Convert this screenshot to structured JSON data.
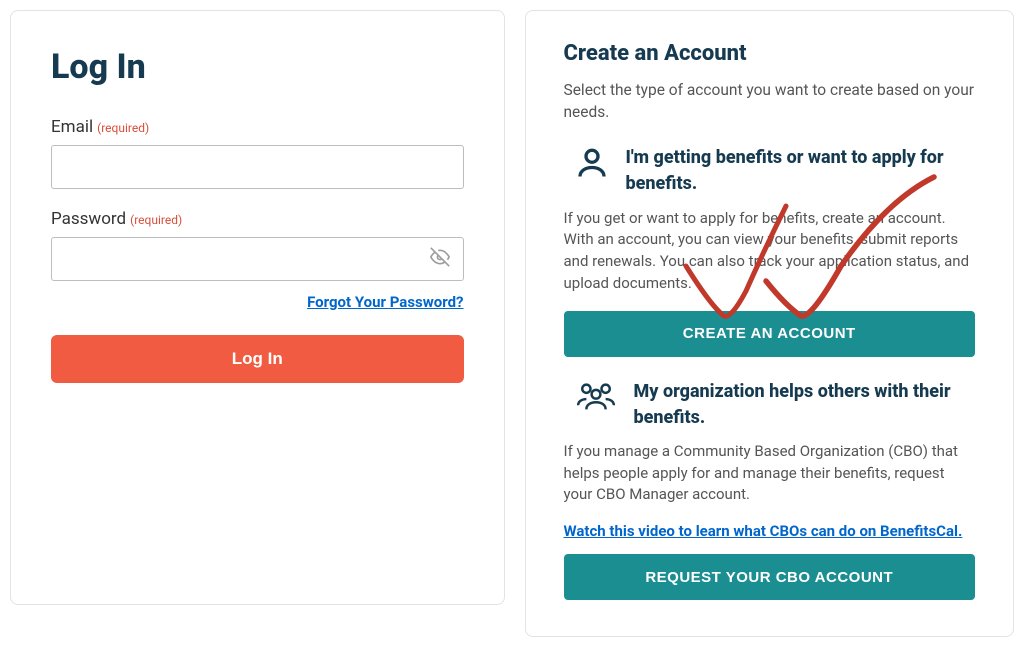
{
  "login": {
    "title": "Log In",
    "email_label": "Email",
    "password_label": "Password",
    "required_tag": "(required)",
    "forgot_link": "Forgot Your Password?",
    "submit_label": "Log In",
    "email_value": "",
    "password_value": ""
  },
  "create": {
    "title": "Create an Account",
    "subtitle": "Select the type of account you want to create based on your needs.",
    "benefits": {
      "heading": "I'm getting benefits or want to apply for benefits.",
      "description": "If you get or want to apply for benefits, create an account. With an account, you can view your benefits, submit reports and renewals. You can also track your application status, and upload documents.",
      "button": "CREATE AN ACCOUNT"
    },
    "cbo": {
      "heading": "My organization helps others with their benefits.",
      "description": "If you manage a Community Based Organization (CBO) that helps people apply for and manage their benefits, request your CBO Manager account.",
      "video_link": "Watch this video to learn what CBOs can do on BenefitsCal.",
      "button": "REQUEST YOUR CBO ACCOUNT"
    }
  },
  "colors": {
    "heading": "#163a50",
    "primary_button": "#f05b41",
    "secondary_button": "#1b8e92",
    "link": "#0066cc",
    "required": "#d84e3a"
  }
}
